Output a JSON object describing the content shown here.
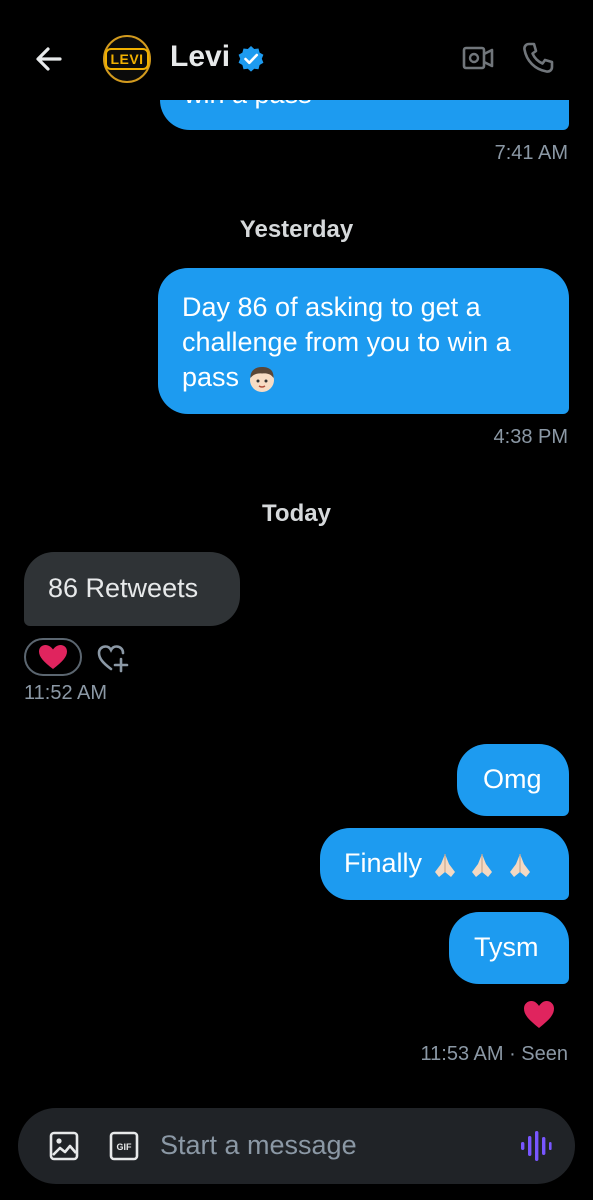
{
  "header": {
    "contact_name": "Levi",
    "avatar_text": "LEVI",
    "verified": true
  },
  "messages": {
    "partial_text": "win a pass",
    "partial_time": "7:41 AM",
    "day1": "Yesterday",
    "msg1_lines": [
      "Day 86  of asking to get a",
      "challenge from you to win a",
      "pass"
    ],
    "msg1_time": "4:38 PM",
    "day2": "Today",
    "incoming_text": "86 Retweets",
    "incoming_time": "11:52 AM",
    "omg": "Omg",
    "finally": "Finally",
    "tysm": "Tysm",
    "last_status": "11:53 AM · Seen"
  },
  "composer": {
    "placeholder": "Start a message"
  },
  "icons": {
    "back": "back-arrow-icon",
    "verified": "verified-badge-icon",
    "video": "video-call-icon",
    "phone": "phone-call-icon",
    "reaction": "heart-emoji",
    "add_reaction": "add-reaction-icon",
    "image": "image-icon",
    "gif": "gif-icon",
    "voice": "voice-message-icon"
  },
  "colors": {
    "outgoing_bubble": "#1d9bf0",
    "incoming_bubble": "#2f3336",
    "background": "#000000",
    "voice_accent": "#7856ff",
    "heart": "#e0245e"
  }
}
